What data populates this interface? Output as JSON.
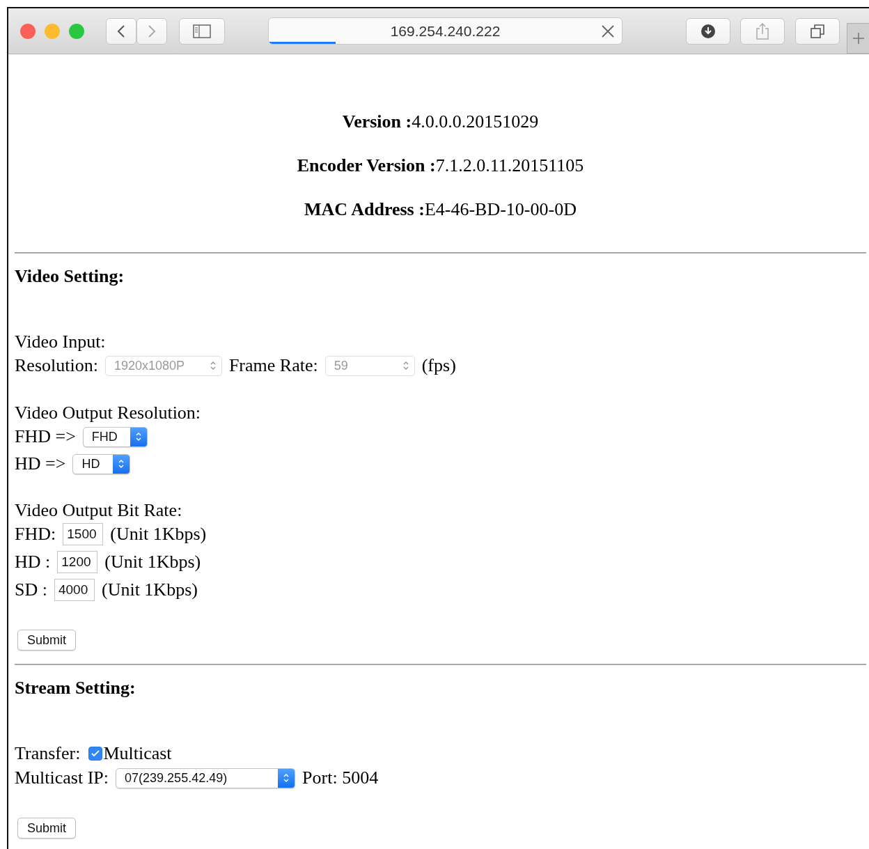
{
  "browser": {
    "address_bar": {
      "url": "169.254.240.222",
      "level": 0.19
    }
  },
  "info": [
    {
      "label": "Version :",
      "value": "4.0.0.0.20151029"
    },
    {
      "label": "Encoder Version :",
      "value": "7.1.2.0.11.20151105"
    },
    {
      "label": "MAC Address :",
      "value": "E4-46-BD-10-00-0D"
    }
  ],
  "video_setting": {
    "title": "Video Setting:",
    "input_heading": "Video Input:",
    "resolution": {
      "label": "Resolution:",
      "value": "1920x1080P",
      "disabled": true
    },
    "frame_rate": {
      "label": "Frame Rate:",
      "value": "59",
      "disabled": true,
      "unit": "(fps)"
    },
    "output_resolution": {
      "heading": "Video Output Resolution:",
      "rows": [
        {
          "label": "FHD =>",
          "value": "FHD",
          "disabled": false
        },
        {
          "label": "HD =>",
          "value": "HD",
          "disabled": false
        }
      ]
    },
    "bit_rate": {
      "heading": "Video Output Bit Rate:",
      "rows": [
        {
          "label": "FHD:",
          "value": "1500",
          "unit": "(Unit 1Kbps)"
        },
        {
          "label": "HD :",
          "value": "1200",
          "unit": "(Unit 1Kbps)"
        },
        {
          "label": "SD :",
          "value": "4000",
          "unit": "(Unit 1Kbps)"
        }
      ]
    },
    "submit": "Submit"
  },
  "stream_setting": {
    "title": "Stream Setting:",
    "transfer": {
      "label": "Transfer:",
      "option": "Multicast",
      "checked": true
    },
    "multicast_ip": {
      "label": "Multicast IP:",
      "value": "07(239.255.42.49)",
      "disabled": false
    },
    "port": "Port: 5004",
    "submit": "Submit"
  }
}
